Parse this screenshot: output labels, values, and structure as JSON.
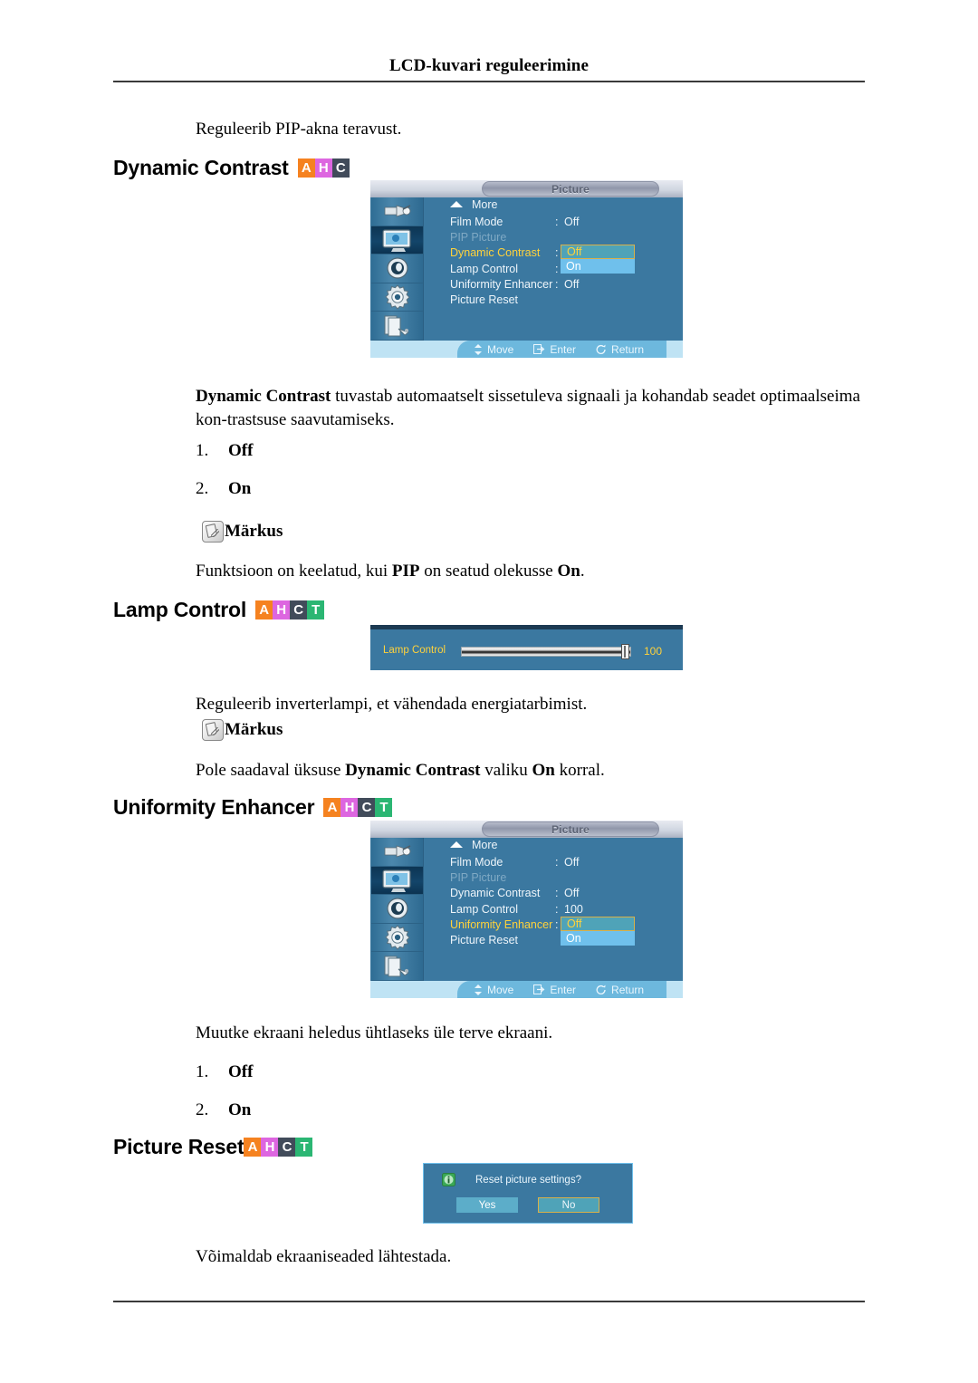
{
  "document": {
    "running_head": "LCD-kuvari reguleerimine"
  },
  "intro": {
    "text": "Reguleerib PIP-akna teravust."
  },
  "sections": {
    "dynamic_contrast": {
      "heading": "Dynamic Contrast",
      "badges": [
        {
          "letter": "A",
          "color": "#F58220"
        },
        {
          "letter": "H",
          "color": "#DD66E0"
        },
        {
          "letter": "C",
          "color": "#414B5A"
        }
      ],
      "description_lead": "Dynamic Contrast",
      "description_rest": " tuvastab automaatselt sissetuleva signaali ja kohandab seadet optimaalseima kon-trastsuse saavutamiseks.",
      "options": [
        {
          "num": "1.",
          "label": "Off"
        },
        {
          "num": "2.",
          "label": "On"
        }
      ],
      "note_label": "Märkus",
      "note_pre": "Funktsioon on keelatud, kui ",
      "note_bold1": "PIP",
      "note_mid": " on seatud olekusse ",
      "note_bold2": "On",
      "note_end": "."
    },
    "lamp_control": {
      "heading": "Lamp Control",
      "badges": [
        {
          "letter": "A",
          "color": "#F58220"
        },
        {
          "letter": "H",
          "color": "#DD66E0"
        },
        {
          "letter": "C",
          "color": "#414B5A"
        },
        {
          "letter": "T",
          "color": "#2BB673"
        }
      ],
      "description": "Reguleerib inverterlampi, et vähendada energiatarbimist.",
      "note_label": "Märkus",
      "note_pre": "Pole saadaval üksuse ",
      "note_bold1": "Dynamic Contrast",
      "note_mid": " valiku ",
      "note_bold2": "On",
      "note_end": " korral."
    },
    "uniformity_enhancer": {
      "heading": "Uniformity Enhancer",
      "badges": [
        {
          "letter": "A",
          "color": "#F58220"
        },
        {
          "letter": "H",
          "color": "#DD66E0"
        },
        {
          "letter": "C",
          "color": "#414B5A"
        },
        {
          "letter": "T",
          "color": "#2BB673"
        }
      ],
      "description": "Muutke ekraani heledus ühtlaseks üle terve ekraani.",
      "options": [
        {
          "num": "1.",
          "label": "Off"
        },
        {
          "num": "2.",
          "label": "On"
        }
      ]
    },
    "picture_reset": {
      "heading": "Picture Reset",
      "badges": [
        {
          "letter": "A",
          "color": "#F58220"
        },
        {
          "letter": "H",
          "color": "#DD66E0"
        },
        {
          "letter": "C",
          "color": "#414B5A"
        },
        {
          "letter": "T",
          "color": "#2BB673"
        }
      ],
      "description": "Võimaldab ekraaniseaded lähtestada."
    }
  },
  "osd_menu_1": {
    "title": "Picture",
    "sidebar_icons": [
      "input-source-icon",
      "picture-icon",
      "sound-icon",
      "setup-gear-icon",
      "multi-control-icon"
    ],
    "selected_sidebar_index": 1,
    "more_label": "More",
    "rows": [
      {
        "label": "Film Mode",
        "value": "Off",
        "state": "normal"
      },
      {
        "label": "PIP Picture",
        "value": "",
        "state": "dim"
      },
      {
        "label": "Dynamic Contrast",
        "value": "",
        "state": "active"
      },
      {
        "label": "Lamp Control",
        "value": "",
        "state": "normal"
      },
      {
        "label": "Uniformity Enhancer",
        "value": "Off",
        "state": "normal"
      },
      {
        "label": "Picture Reset",
        "value": "",
        "state": "normal"
      }
    ],
    "dropdown": {
      "selected": "Off",
      "other": "On"
    },
    "footer": [
      {
        "glyph": "updown-arrow-icon",
        "label": "Move"
      },
      {
        "glyph": "enter-icon",
        "label": "Enter"
      },
      {
        "glyph": "return-icon",
        "label": "Return"
      }
    ]
  },
  "osd_menu_2": {
    "title": "Picture",
    "sidebar_icons": [
      "input-source-icon",
      "picture-icon",
      "sound-icon",
      "setup-gear-icon",
      "multi-control-icon"
    ],
    "selected_sidebar_index": 1,
    "more_label": "More",
    "rows": [
      {
        "label": "Film Mode",
        "value": "Off",
        "state": "normal"
      },
      {
        "label": "PIP Picture",
        "value": "",
        "state": "dim"
      },
      {
        "label": "Dynamic Contrast",
        "value": "Off",
        "state": "normal"
      },
      {
        "label": "Lamp Control",
        "value": "100",
        "state": "normal"
      },
      {
        "label": "Uniformity Enhancer",
        "value": "",
        "state": "active"
      },
      {
        "label": "Picture Reset",
        "value": "",
        "state": "normal"
      }
    ],
    "dropdown": {
      "selected": "Off",
      "other": "On"
    },
    "footer": [
      {
        "glyph": "updown-arrow-icon",
        "label": "Move"
      },
      {
        "glyph": "enter-icon",
        "label": "Enter"
      },
      {
        "glyph": "return-icon",
        "label": "Return"
      }
    ]
  },
  "lamp_slider": {
    "label": "Lamp Control",
    "value": "100",
    "percent": 100
  },
  "reset_dialog": {
    "message": "Reset picture settings?",
    "yes_label": "Yes",
    "no_label": "No",
    "selected": "No"
  }
}
